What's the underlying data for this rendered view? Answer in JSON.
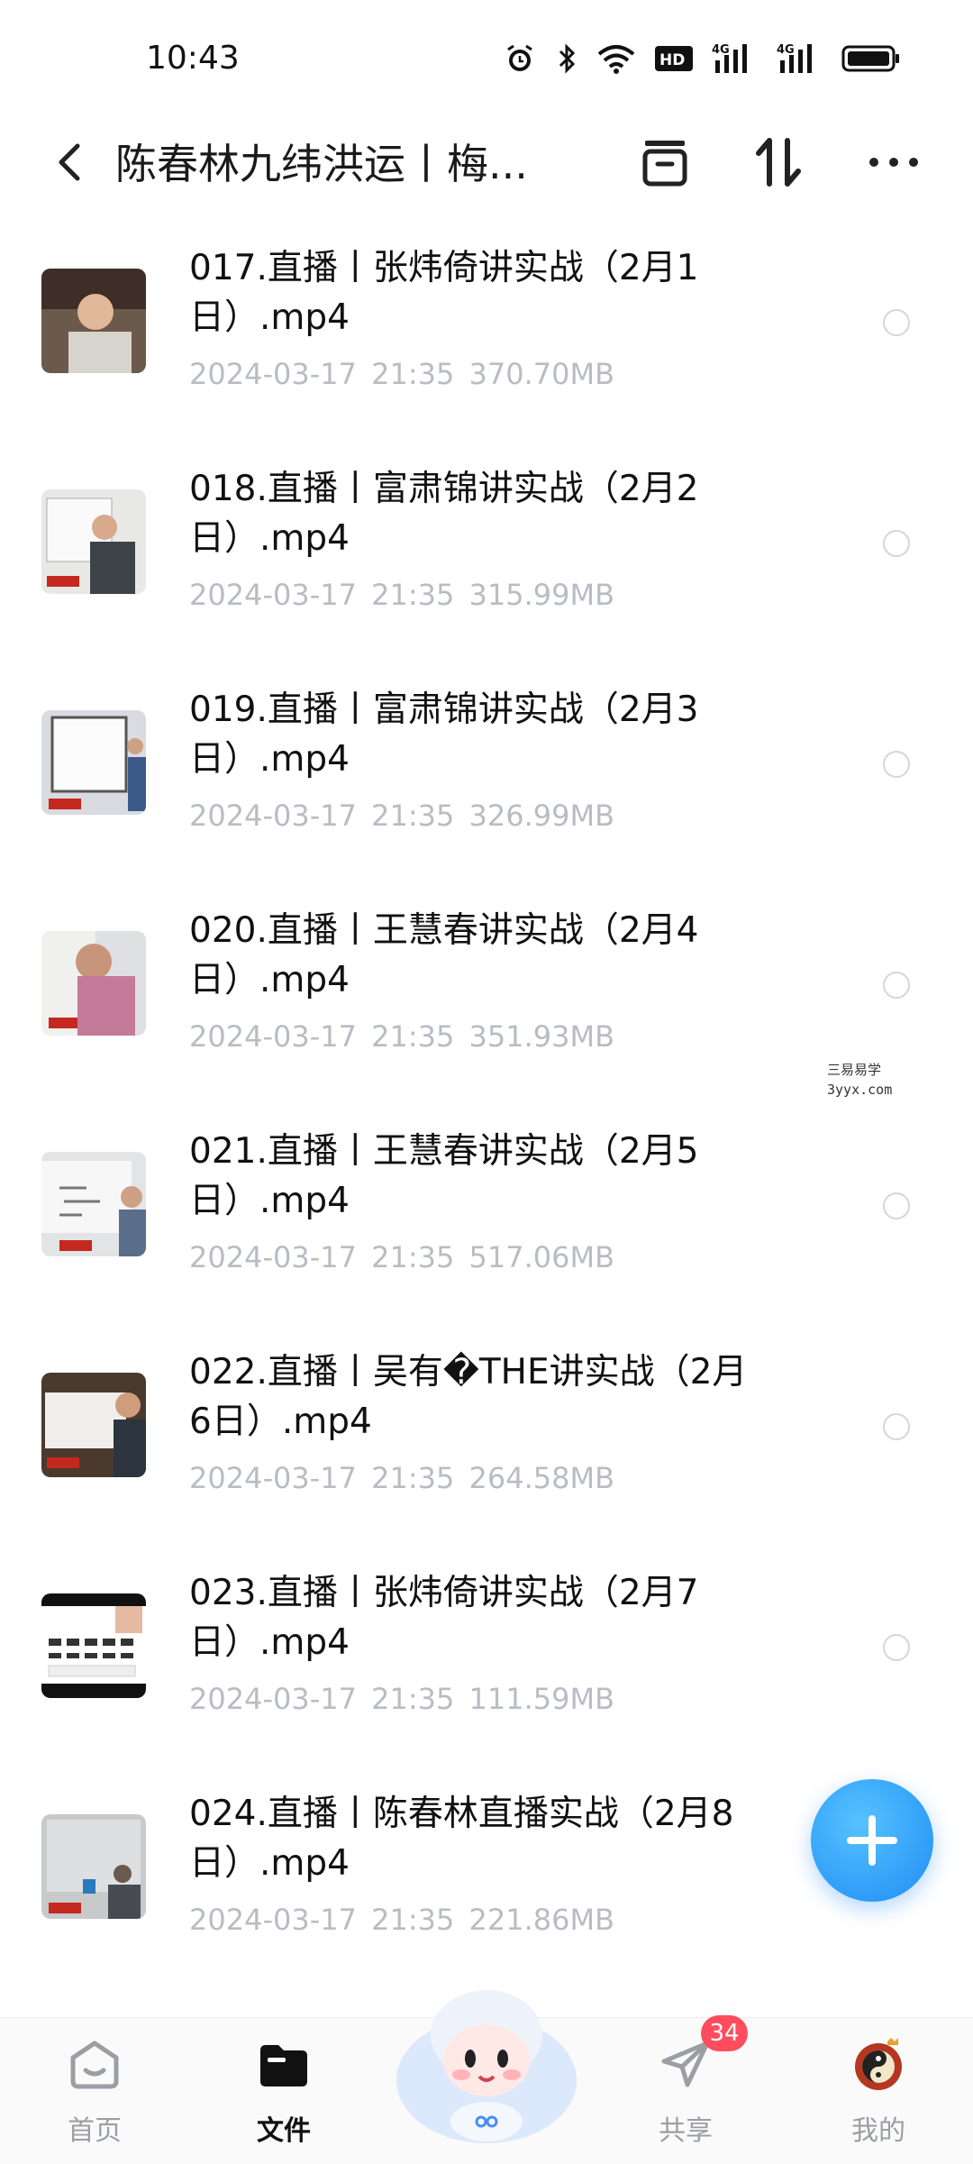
{
  "status_bar": {
    "time": "10:43",
    "hd_label": "HD",
    "net_1": "4G",
    "net_2": "4G"
  },
  "header": {
    "title": "陈春林九纬洪运丨梅..."
  },
  "files": [
    {
      "name": "017.直播丨张炜倚讲实战（2月1日）.mp4",
      "date": "2024-03-17",
      "time": "21:35",
      "size": "370.70MB"
    },
    {
      "name": "018.直播丨富肃锦讲实战（2月2日）.mp4",
      "date": "2024-03-17",
      "time": "21:35",
      "size": "315.99MB"
    },
    {
      "name": "019.直播丨富肃锦讲实战（2月3日）.mp4",
      "date": "2024-03-17",
      "time": "21:35",
      "size": "326.99MB"
    },
    {
      "name": "020.直播丨王慧春讲实战（2月4日）.mp4",
      "date": "2024-03-17",
      "time": "21:35",
      "size": "351.93MB"
    },
    {
      "name": "021.直播丨王慧春讲实战（2月5日）.mp4",
      "date": "2024-03-17",
      "time": "21:35",
      "size": "517.06MB"
    },
    {
      "name": "022.直播丨吴有�THE讲实战（2月6日）.mp4",
      "date": "2024-03-17",
      "time": "21:35",
      "size": "264.58MB"
    },
    {
      "name": "023.直播丨张炜倚讲实战（2月7日）.mp4",
      "date": "2024-03-17",
      "time": "21:35",
      "size": "111.59MB"
    },
    {
      "name": "024.直播丨陈春林直播实战（2月8日）.mp4",
      "date": "2024-03-17",
      "time": "21:35",
      "size": "221.86MB"
    }
  ],
  "watermark": {
    "line1": "三易易学",
    "line2": "3yyx.com"
  },
  "bottom_nav": {
    "home": "首页",
    "files": "文件",
    "share": "共享",
    "mine": "我的",
    "share_badge": "34"
  },
  "colors": {
    "accent": "#1f8df5",
    "badge": "#ff4d5e",
    "meta_text": "#b8bcc4"
  },
  "icons": {
    "header": [
      "back-arrow-icon",
      "archive-box-icon",
      "sort-icon",
      "more-icon"
    ],
    "nav": [
      "home-icon",
      "folder-icon",
      "paper-plane-icon",
      "avatar-icon"
    ]
  }
}
